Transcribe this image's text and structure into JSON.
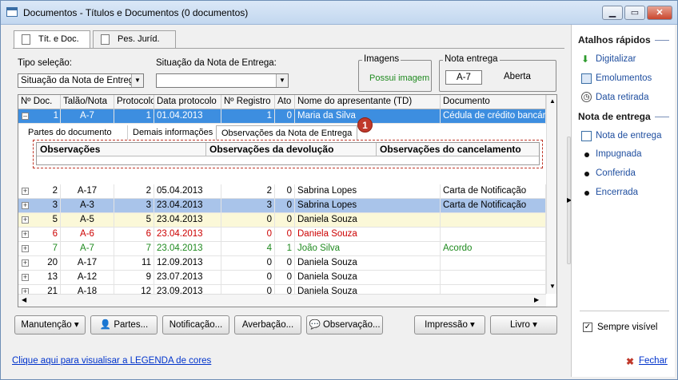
{
  "window": {
    "title": "Documentos - Títulos e Documentos (0 documentos)",
    "min": "▁",
    "max": "▭",
    "close": "✕"
  },
  "tabs": [
    {
      "label": "Tít. e Doc.",
      "active": true
    },
    {
      "label": "Pes. Juríd.",
      "active": false
    }
  ],
  "filters": {
    "tipo_label": "Tipo seleção:",
    "tipo_value": "Situação da Nota de Entrega",
    "situacao_label": "Situação da Nota de Entrega:",
    "situacao_value": "",
    "imagens_title": "Imagens",
    "imagens_value": "Possui imagem",
    "nota_title": "Nota entrega",
    "nota_value": "A-7",
    "nota_status": "Aberta"
  },
  "grid": {
    "columns": [
      "Nº Doc.",
      "Talão/Nota",
      "Protocolo",
      "Data protocolo",
      "Nº Registro",
      "Ato",
      "Nome do apresentante (TD)",
      "Documento"
    ],
    "expanded_row": {
      "doc": "1",
      "talao": "A-7",
      "protocolo": "1",
      "data": "01.04.2013",
      "registro": "1",
      "ato": "0",
      "nome": "Maria da Silva",
      "documento": "Cédula de crédito bancário",
      "expander": "–"
    },
    "detail_tabs": [
      "Partes do documento",
      "Demais informações",
      "Observações da Nota de Entrega"
    ],
    "detail_columns": [
      "Observações",
      "Observações da devolução",
      "Observações do cancelamento"
    ],
    "rows": [
      {
        "doc": "2",
        "talao": "A-17",
        "protocolo": "2",
        "data": "05.04.2013",
        "registro": "2",
        "ato": "0",
        "nome": "Sabrina Lopes",
        "documento": "Carta de Notificação",
        "style": "normal"
      },
      {
        "doc": "3",
        "talao": "A-3",
        "protocolo": "3",
        "data": "23.04.2013",
        "registro": "3",
        "ato": "0",
        "nome": "Sabrina Lopes",
        "documento": "Carta de Notificação",
        "style": "blue"
      },
      {
        "doc": "5",
        "talao": "A-5",
        "protocolo": "5",
        "data": "23.04.2013",
        "registro": "0",
        "ato": "0",
        "nome": "Daniela Souza",
        "documento": "",
        "style": "yellow"
      },
      {
        "doc": "6",
        "talao": "A-6",
        "protocolo": "6",
        "data": "23.04.2013",
        "registro": "0",
        "ato": "0",
        "nome": "Daniela Souza",
        "documento": "",
        "style": "red"
      },
      {
        "doc": "7",
        "talao": "A-7",
        "protocolo": "7",
        "data": "23.04.2013",
        "registro": "4",
        "ato": "1",
        "nome": "João Silva",
        "documento": "Acordo",
        "style": "green"
      },
      {
        "doc": "20",
        "talao": "A-17",
        "protocolo": "11",
        "data": "12.09.2013",
        "registro": "0",
        "ato": "0",
        "nome": "Daniela Souza",
        "documento": "",
        "style": "normal"
      },
      {
        "doc": "13",
        "talao": "A-12",
        "protocolo": "9",
        "data": "23.07.2013",
        "registro": "0",
        "ato": "0",
        "nome": "Daniela Souza",
        "documento": "",
        "style": "normal"
      },
      {
        "doc": "21",
        "talao": "A-18",
        "protocolo": "12",
        "data": "23.09.2013",
        "registro": "0",
        "ato": "0",
        "nome": "Daniela Souza",
        "documento": "",
        "style": "normal"
      }
    ],
    "expander": "+",
    "badge": "1"
  },
  "buttons": {
    "manutencao": "Manutenção",
    "partes": "Partes...",
    "notificacao": "Notificação...",
    "averbacao": "Averbação...",
    "observacao": "Observação...",
    "impressao": "Impressão",
    "livro": "Livro"
  },
  "legend_link": "Clique aqui para visualisar a LEGENDA de cores",
  "sidebar": {
    "quick_title": "Atalhos rápidos",
    "quick": [
      "Digitalizar",
      "Emolumentos",
      "Data retirada"
    ],
    "nota_title": "Nota de entrega",
    "nota_items": [
      "Nota de entrega",
      "Impugnada",
      "Conferida",
      "Encerrada"
    ],
    "always_visible": "Sempre visível",
    "close": "Fechar"
  },
  "colors": {
    "selection": "#3d8ee0",
    "blue_row": "#a9c4ea",
    "yellow_row": "#fbf8d8",
    "red_text": "#cc0000",
    "green_text": "#1f8a1f",
    "link": "#0033cc"
  }
}
